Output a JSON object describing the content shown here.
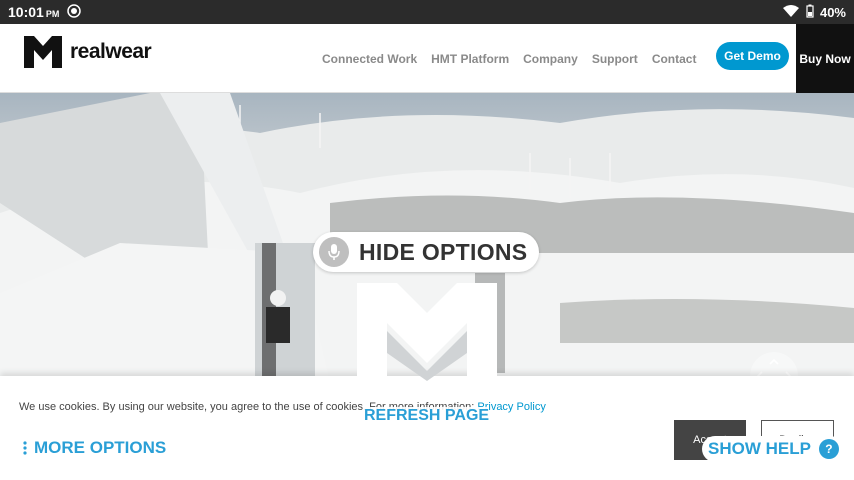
{
  "status_bar": {
    "time": "10:01",
    "ampm": "PM",
    "battery": "40%"
  },
  "header": {
    "logo_text": "realwear",
    "nav": [
      {
        "label": "Connected Work"
      },
      {
        "label": "HMT Platform"
      },
      {
        "label": "Company"
      },
      {
        "label": "Support"
      },
      {
        "label": "Contact"
      }
    ],
    "get_demo": "Get Demo",
    "buy_now": "Buy Now"
  },
  "overlay": {
    "hide_options": "HIDE OPTIONS",
    "refresh_page": "REFRESH PAGE",
    "more_options": "MORE OPTIONS",
    "show_help": "SHOW HELP",
    "help_badge": "?"
  },
  "cookie": {
    "text": "We use cookies. By using our website, you agree to the use of cookies. For more information:",
    "link": "Privacy Policy",
    "accept": "Accept",
    "decline": "Decline"
  },
  "colors": {
    "accent": "#0098d0",
    "voice_blue": "#2a9fd6",
    "buy_now_bg": "#111111"
  }
}
